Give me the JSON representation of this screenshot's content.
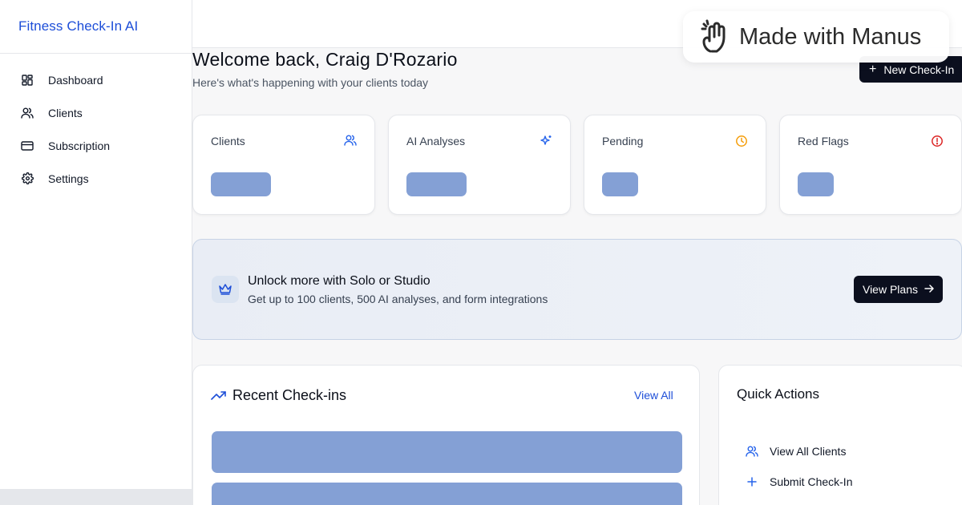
{
  "app": {
    "title": "Fitness Check-In AI"
  },
  "sidebar": {
    "items": [
      {
        "label": "Dashboard",
        "icon": "dashboard-icon"
      },
      {
        "label": "Clients",
        "icon": "users-icon"
      },
      {
        "label": "Subscription",
        "icon": "credit-card-icon"
      },
      {
        "label": "Settings",
        "icon": "gear-icon"
      }
    ]
  },
  "badge": {
    "label": "Made with Manus"
  },
  "header": {
    "welcome": "Welcome back, Craig D'Rozario",
    "subtitle": "Here's what's happening with your clients today",
    "new_checkin_label": "New Check-In"
  },
  "stats": [
    {
      "label": "Clients",
      "icon": "users-icon",
      "icon_color": "#2563eb"
    },
    {
      "label": "AI Analyses",
      "icon": "sparkles-icon",
      "icon_color": "#2563eb"
    },
    {
      "label": "Pending",
      "icon": "clock-icon",
      "icon_color": "#f59e0b"
    },
    {
      "label": "Red Flags",
      "icon": "alert-circle-icon",
      "icon_color": "#dc2626"
    }
  ],
  "upgrade": {
    "title": "Unlock more with Solo or Studio",
    "subtitle": "Get up to 100 clients, 500 AI analyses, and form integrations",
    "button_label": "View Plans"
  },
  "recent": {
    "title": "Recent Check-ins",
    "view_all_label": "View All"
  },
  "quick_actions": {
    "title": "Quick Actions",
    "items": [
      {
        "label": "View All Clients",
        "icon": "users-icon"
      },
      {
        "label": "Submit Check-In",
        "icon": "plus-icon"
      }
    ]
  },
  "colors": {
    "accent": "#1d4ed8",
    "primary_button": "#0b0f1e",
    "skeleton": "#84a0d5"
  }
}
